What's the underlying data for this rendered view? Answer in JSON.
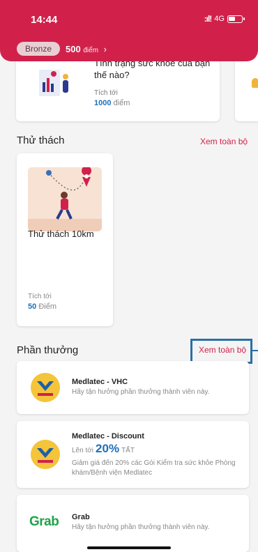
{
  "status_bar": {
    "time": "14:44",
    "signal": ":ıl!",
    "network": "4G"
  },
  "membership": {
    "tier": "Bronze",
    "points_value": "500",
    "points_unit": "điểm",
    "chevron": "›"
  },
  "health_card": {
    "title": "Tình trạng sức khỏe của bạn thế nào?",
    "accumulate_label": "Tích tới",
    "points": "1000",
    "points_unit": "điểm"
  },
  "challenges": {
    "section_title": "Thử thách",
    "see_all": "Xem toàn bộ",
    "items": [
      {
        "title": "Thử thách 10km",
        "accumulate_label": "Tích tới",
        "points": "50",
        "points_unit": "Điểm"
      }
    ]
  },
  "rewards": {
    "section_title": "Phần thưởng",
    "see_all": "Xem toàn bộ",
    "items": [
      {
        "name": "Medlatec - VHC",
        "description": "Hãy tận hưởng phần thưởng thành viên này.",
        "logo": "MEDLATEC"
      },
      {
        "name": "Medlatec - Discount",
        "upto_prefix": "Lên tới",
        "upto_value": "20%",
        "upto_suffix": "TẤT",
        "description": "Giảm giá đến 20% các Gói Kiểm tra sức khỏe Phòng khám/Bệnh viện Medlatec",
        "logo": "MEDLATEC"
      },
      {
        "name": "Grab",
        "description": "Hãy tận hưởng phần thưởng thành viên này.",
        "logo": "Grab"
      }
    ]
  },
  "colors": {
    "brand": "#d1214b",
    "accent_blue": "#1d6fb8",
    "highlight": "#2a6fa6",
    "grab_green": "#1ea34a",
    "medlatec_yellow": "#f4c43a"
  }
}
